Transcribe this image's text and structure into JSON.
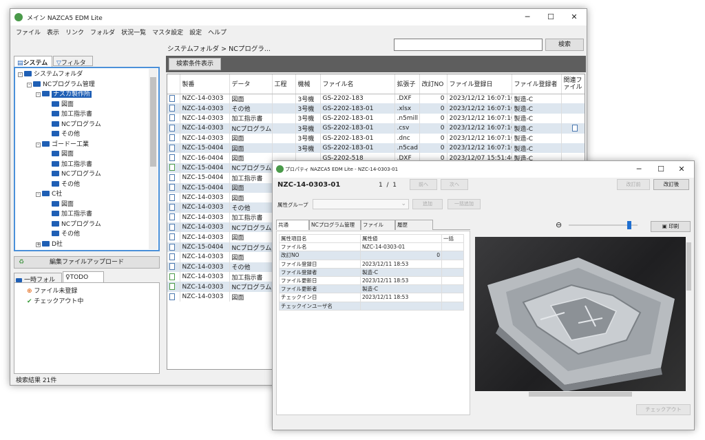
{
  "main": {
    "title": "メイン NAZCA5 EDM Lite",
    "menu": [
      "ファイル",
      "表示",
      "リンク",
      "フォルダ",
      "状況一覧",
      "マスタ設定",
      "設定",
      "ヘルプ"
    ],
    "breadcrumb": "システムフォルダ > NCプログラ...",
    "search_value": "",
    "search_button": "検索",
    "search_cond_button": "検索条件表示",
    "tabs": [
      "システム",
      "フィルタ"
    ],
    "upload_button": "編集ファイルアップロード",
    "sub_tabs": [
      "一時フォルダ",
      "TODO"
    ],
    "todo": [
      "ファイル未登録",
      "チェックアウト中"
    ],
    "status": "検索結果 21件",
    "tree": [
      {
        "label": "システムフォルダ",
        "lvl": 0,
        "pm": "-"
      },
      {
        "label": "NCプログラム管理",
        "lvl": 1,
        "pm": "-"
      },
      {
        "label": "ナスカ製作所",
        "lvl": 2,
        "pm": "-",
        "sel": true
      },
      {
        "label": "図面",
        "lvl": 3
      },
      {
        "label": "加工指示書",
        "lvl": 3
      },
      {
        "label": "NCプログラム",
        "lvl": 3
      },
      {
        "label": "その他",
        "lvl": 3
      },
      {
        "label": "ゴードー工業",
        "lvl": 2,
        "pm": "-"
      },
      {
        "label": "図面",
        "lvl": 3
      },
      {
        "label": "加工指示書",
        "lvl": 3
      },
      {
        "label": "NCプログラム",
        "lvl": 3
      },
      {
        "label": "その他",
        "lvl": 3
      },
      {
        "label": "C社",
        "lvl": 2,
        "pm": "-"
      },
      {
        "label": "図面",
        "lvl": 3
      },
      {
        "label": "加工指示書",
        "lvl": 3
      },
      {
        "label": "NCプログラム",
        "lvl": 3
      },
      {
        "label": "その他",
        "lvl": 3
      },
      {
        "label": "D社",
        "lvl": 2,
        "pm": "+"
      }
    ],
    "columns": [
      "",
      "製番",
      "データ",
      "工程",
      "機械",
      "ファイル名",
      "拡張子",
      "改訂NO",
      "ファイル登録日",
      "ファイル登録者",
      "関連ファイル"
    ],
    "rows": [
      [
        "doc",
        "NZC-14-0303",
        "図面",
        "",
        "3号機",
        "GS-2202-183",
        ".DXF",
        "0",
        "2023/12/12 16:07:16",
        "製造-C",
        ""
      ],
      [
        "doc",
        "NZC-14-0303",
        "その他",
        "",
        "3号機",
        "GS-2202-183-01",
        ".xlsx",
        "0",
        "2023/12/12 16:07:16",
        "製造-C",
        ""
      ],
      [
        "doc",
        "NZC-14-0303",
        "加工指示書",
        "",
        "3号機",
        "GS-2202-183-01",
        ".n5mill",
        "0",
        "2023/12/12 16:07:16",
        "製造-C",
        ""
      ],
      [
        "doc",
        "NZC-14-0303",
        "NCプログラム",
        "",
        "3号機",
        "GS-2202-183-01",
        ".csv",
        "0",
        "2023/12/12 16:07:16",
        "製造-C",
        "doc"
      ],
      [
        "doc",
        "NZC-14-0303",
        "図面",
        "",
        "3号機",
        "GS-2202-183-01",
        ".dnc",
        "0",
        "2023/12/12 16:07:16",
        "製造-C",
        ""
      ],
      [
        "doc",
        "NZC-15-0404",
        "図面",
        "",
        "3号機",
        "GS-2202-183-01",
        ".n5cad",
        "0",
        "2023/12/12 16:07:16",
        "製造-C",
        ""
      ],
      [
        "doc",
        "NZC-16-0404",
        "図面",
        "",
        "",
        "GS-2202-518",
        ".DXF",
        "0",
        "2023/12/07 15:51:40",
        "製造-C",
        ""
      ],
      [
        "ok",
        "NZC-15-0404",
        "NCプログラム",
        "",
        "",
        "",
        "",
        "",
        "",
        "",
        ""
      ],
      [
        "doc",
        "NZC-15-0404",
        "加工指示書",
        "",
        "",
        "",
        "",
        "",
        "",
        "",
        ""
      ],
      [
        "doc",
        "NZC-15-0404",
        "図面",
        "",
        "",
        "",
        "",
        "",
        "",
        "",
        ""
      ],
      [
        "doc",
        "NZC-14-0303",
        "図面",
        "",
        "",
        "",
        "",
        "",
        "",
        "",
        ""
      ],
      [
        "doc",
        "NZC-14-0303",
        "その他",
        "",
        "",
        "",
        "",
        "",
        "",
        "",
        ""
      ],
      [
        "doc",
        "NZC-14-0303",
        "加工指示書",
        "",
        "",
        "",
        "",
        "",
        "",
        "",
        ""
      ],
      [
        "doc",
        "NZC-14-0303",
        "NCプログラム",
        "",
        "",
        "",
        "",
        "",
        "",
        "",
        ""
      ],
      [
        "doc",
        "NZC-14-0303",
        "図面",
        "",
        "",
        "",
        "",
        "",
        "",
        "",
        ""
      ],
      [
        "doc",
        "NZC-15-0404",
        "NCプログラム",
        "",
        "",
        "",
        "",
        "",
        "",
        "",
        ""
      ],
      [
        "doc",
        "NZC-14-0303",
        "図面",
        "",
        "",
        "",
        "",
        "",
        "",
        "",
        ""
      ],
      [
        "doc",
        "NZC-14-0303",
        "その他",
        "",
        "",
        "",
        "",
        "",
        "",
        "",
        ""
      ],
      [
        "ok",
        "NZC-14-0303",
        "加工指示書",
        "",
        "",
        "",
        "",
        "",
        "",
        "",
        ""
      ],
      [
        "ok",
        "NZC-14-0303",
        "NCプログラム",
        "",
        "",
        "",
        "",
        "",
        "",
        "",
        ""
      ],
      [
        "doc",
        "NZC-14-0303",
        "図面",
        "",
        "",
        "",
        "",
        "",
        "",
        "",
        ""
      ]
    ]
  },
  "prop": {
    "title": "プロパティ NAZCA5 EDM Lite - NZC-14-0303-01",
    "heading": "NZC-14-0303-01",
    "page_current": "1",
    "page_sep": "/",
    "page_total": "1",
    "prev": "前へ",
    "next": "次へ",
    "rev_prev": "改訂前",
    "rev_next": "改訂後",
    "group_label": "属性グループ",
    "add": "追加",
    "batch_add": "一括追加",
    "tabs": [
      "共通",
      "NCプログラム管理",
      "ファイル",
      "履歴"
    ],
    "print": "印刷",
    "checkout": "チェックアウト",
    "attr_cols": [
      "属性項目名",
      "属性値",
      "一括"
    ],
    "attrs": [
      [
        "ファイル名",
        "NZC-14-0303-01"
      ],
      [
        "改訂NO",
        "0"
      ],
      [
        "ファイル登録日",
        "2023/12/11 18:53"
      ],
      [
        "ファイル登録者",
        "製造-C"
      ],
      [
        "ファイル更新日",
        "2023/12/11 18:53"
      ],
      [
        "ファイル更新者",
        "製造-C"
      ],
      [
        "チェックイン日",
        "2023/12/11 18:53"
      ],
      [
        "チェックインユーザ名",
        ""
      ]
    ],
    "zoom_level": 0.9
  }
}
